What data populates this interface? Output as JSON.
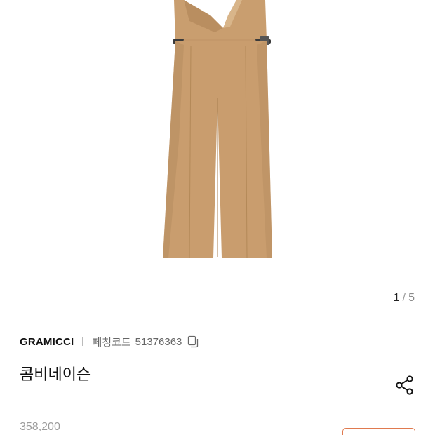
{
  "gallery": {
    "current": "1",
    "separator": "/",
    "total": "5"
  },
  "product": {
    "brand": "GRAMICCI",
    "code_label": "페칭코드",
    "code_value": "51376363",
    "title": "콤비네이슨",
    "original_price": "358,200"
  },
  "icons": {
    "copy": "copy-icon",
    "share": "share-icon"
  },
  "colors": {
    "garment": "#c99d6e",
    "accent": "#e07a4f"
  }
}
